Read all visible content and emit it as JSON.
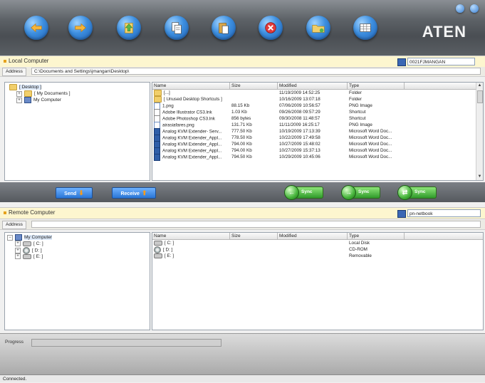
{
  "toolbar": {
    "buttons": [
      {
        "name": "back-button",
        "icon": "arrow-left-icon"
      },
      {
        "name": "forward-button",
        "icon": "arrow-right-icon"
      },
      {
        "name": "up-folder-button",
        "icon": "arrow-up-icon"
      },
      {
        "name": "copy-button",
        "icon": "copy-icon"
      },
      {
        "name": "paste-button",
        "icon": "paste-icon"
      },
      {
        "name": "delete-button",
        "icon": "close-icon"
      },
      {
        "name": "new-folder-button",
        "icon": "folder-icon"
      },
      {
        "name": "view-button",
        "icon": "grid-icon"
      }
    ],
    "logo": "ATEN"
  },
  "local": {
    "title": "Local Computer",
    "computer_name": "0021FJMANGAN",
    "address_label": "Address",
    "address": "C:\\Documents and Settings\\jmangan\\Desktop\\",
    "tree": [
      {
        "label": "[ Desktop ]",
        "depth": 0
      },
      {
        "label": "[ My Documents ]",
        "depth": 1
      },
      {
        "label": "My Computer",
        "depth": 1
      }
    ],
    "columns": [
      "Name",
      "Size",
      "Modified",
      "Type"
    ],
    "files": [
      {
        "name": "[...]",
        "size": "",
        "modified": "11/19/2009 14:52:25",
        "type": "Folder",
        "icon": "folder"
      },
      {
        "name": "[ Unused Desktop Shortcuts ]",
        "size": "",
        "modified": "10/16/2009 13:07:18",
        "type": "Folder",
        "icon": "folder"
      },
      {
        "name": "1.png",
        "size": "88.15 Kb",
        "modified": "07/06/2009 10:56:57",
        "type": "PNG Image",
        "icon": "img"
      },
      {
        "name": "Adobe Illustrator CS3.lnk",
        "size": "1.03 Kb",
        "modified": "09/26/2008 09:57:29",
        "type": "Shortcut",
        "icon": "lnk"
      },
      {
        "name": "Adobe Photoshop CS3.lnk",
        "size": "856 bytes",
        "modified": "09/30/2008 11:48:57",
        "type": "Shortcut",
        "icon": "lnk"
      },
      {
        "name": "airasiafares.png",
        "size": "131.71 Kb",
        "modified": "11/11/2009 16:25:17",
        "type": "PNG Image",
        "icon": "img"
      },
      {
        "name": "Analog KVM Extender- Serv...",
        "size": "777.50 Kb",
        "modified": "10/19/2009 17:13:39",
        "type": "Microsoft Word Doc...",
        "icon": "doc"
      },
      {
        "name": "Analog KVM Extender_Appl...",
        "size": "778.50 Kb",
        "modified": "10/22/2009 17:49:58",
        "type": "Microsoft Word Doc...",
        "icon": "doc"
      },
      {
        "name": "Analog KVM Extender_Appl...",
        "size": "794.00 Kb",
        "modified": "10/27/2009 15:48:02",
        "type": "Microsoft Word Doc...",
        "icon": "doc"
      },
      {
        "name": "Analog KVM Extender_Appl...",
        "size": "794.00 Kb",
        "modified": "10/27/2009 15:37:13",
        "type": "Microsoft Word Doc...",
        "icon": "doc"
      },
      {
        "name": "Analog KVM Extender_Appl...",
        "size": "794.50 Kb",
        "modified": "10/29/2009 10:45:06",
        "type": "Microsoft Word Doc...",
        "icon": "doc"
      }
    ]
  },
  "transfer": {
    "send_label": "Send",
    "receive_label": "Receive",
    "sync_label": "Sync",
    "sync_buttons": [
      {
        "name": "sync-left-button",
        "glyph": "←"
      },
      {
        "name": "sync-right-button",
        "glyph": "→"
      },
      {
        "name": "sync-both-button",
        "glyph": "⇄"
      }
    ]
  },
  "remote": {
    "title": "Remote Computer",
    "computer_name": "pn-netbook",
    "address_label": "Address",
    "address": "",
    "tree": [
      {
        "label": "My Computer",
        "depth": 0,
        "icon": "pc"
      },
      {
        "label": "[ C: ]",
        "depth": 1,
        "icon": "drive"
      },
      {
        "label": "[ D: ]",
        "depth": 1,
        "icon": "cd"
      },
      {
        "label": "[ E: ]",
        "depth": 1,
        "icon": "drive"
      }
    ],
    "columns": [
      "Name",
      "Size",
      "Modified",
      "Type"
    ],
    "files": [
      {
        "name": "[ C: ]",
        "size": "",
        "modified": "",
        "type": "Local Disk",
        "icon": "drive"
      },
      {
        "name": "[ D: ]",
        "size": "",
        "modified": "",
        "type": "CD-ROM",
        "icon": "cd"
      },
      {
        "name": "[ E: ]",
        "size": "",
        "modified": "",
        "type": "Removable",
        "icon": "drive"
      }
    ]
  },
  "progress_label": "Progress",
  "status": "Connected."
}
